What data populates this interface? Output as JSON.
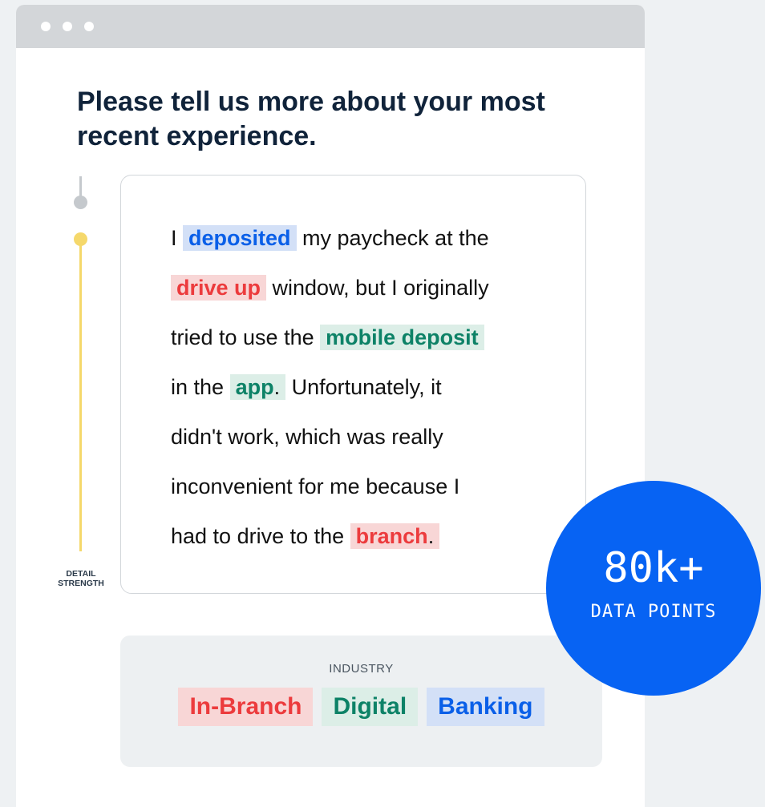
{
  "window": {
    "dots": [
      "",
      "",
      ""
    ]
  },
  "heading": "Please tell us more about your most recent experience.",
  "slider": {
    "label_line1": "DETAIL",
    "label_line2": "STRENGTH"
  },
  "response": {
    "lines": [
      [
        {
          "t": "I "
        },
        {
          "t": "deposited",
          "hl": "blue"
        },
        {
          "t": " my paycheck at the"
        }
      ],
      [
        {
          "t": "drive up",
          "hl": "red"
        },
        {
          "t": " window, but I originally"
        }
      ],
      [
        {
          "t": "tried to use the "
        },
        {
          "t": "mobile deposit",
          "hl": "green"
        }
      ],
      [
        {
          "t": "in the "
        },
        {
          "t": "app",
          "hl": "green",
          "tail": "."
        },
        {
          "t": " Unfortunately, it"
        }
      ],
      [
        {
          "t": "didn't work, which was really"
        }
      ],
      [
        {
          "t": "inconvenient for me because I"
        }
      ],
      [
        {
          "t": "had to drive to the "
        },
        {
          "t": "branch",
          "hl": "red",
          "tail": "."
        }
      ]
    ]
  },
  "industry": {
    "label": "INDUSTRY",
    "tags": [
      {
        "label": "In-Branch",
        "color": "red"
      },
      {
        "label": "Digital",
        "color": "green"
      },
      {
        "label": "Banking",
        "color": "blue"
      }
    ]
  },
  "badge": {
    "value": "80k+",
    "label": "DATA POINTS"
  },
  "colors": {
    "accent_blue": "#0763f3",
    "highlight_red": "#ec3b3d",
    "highlight_green": "#0d8267",
    "highlight_blue": "#0a5fe8",
    "slider_yellow": "#f5d86b"
  }
}
